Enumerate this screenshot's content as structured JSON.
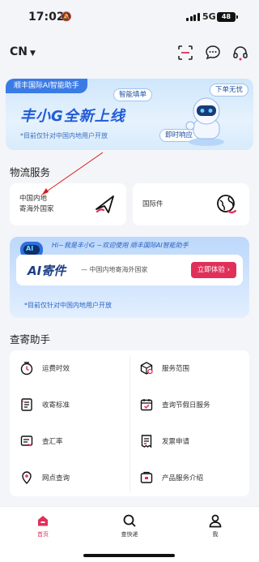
{
  "status_bar": {
    "time": "17:02",
    "network": "5G",
    "battery": "48"
  },
  "header": {
    "region": "CN"
  },
  "banner": {
    "tag": "顺丰国际AI智能助手",
    "title": "丰小G全新上线",
    "subtitle": "*目前仅针对中国内地用户开放",
    "pills": [
      "智能填单",
      "下单无忧",
      "即时响应"
    ]
  },
  "logistics": {
    "title": "物流服务",
    "card1": {
      "line1": "中国内地",
      "line2": "寄海外国家"
    },
    "card2": {
      "label": "国际件"
    }
  },
  "ai_card": {
    "head": "Hi~我是丰小G ~欢迎使用 顺丰国际AI智能助手",
    "badge": "AI",
    "title": "AI寄件",
    "desc": "— 中国内地寄海外国家",
    "button": "立即体验",
    "foot": "*目前仅针对中国内地用户开放"
  },
  "helper": {
    "title": "查寄助手",
    "items": [
      {
        "label": "运费时效",
        "icon": "clock-icon"
      },
      {
        "label": "服务范围",
        "icon": "box-icon"
      },
      {
        "label": "收寄标准",
        "icon": "document-icon"
      },
      {
        "label": "查询节假日服务",
        "icon": "calendar-icon"
      },
      {
        "label": "查汇率",
        "icon": "exchange-icon"
      },
      {
        "label": "发票申请",
        "icon": "invoice-icon"
      },
      {
        "label": "网点查询",
        "icon": "location-icon"
      },
      {
        "label": "产品服务介绍",
        "icon": "product-icon"
      }
    ]
  },
  "tabbar": {
    "tabs": [
      {
        "label": "首页",
        "active": true
      },
      {
        "label": "查快递",
        "active": false
      },
      {
        "label": "我",
        "active": false
      }
    ]
  },
  "colors": {
    "accent": "#e0305a",
    "brand_blue": "#1f5bd8"
  }
}
